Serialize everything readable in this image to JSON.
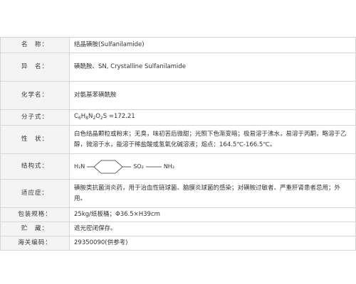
{
  "rows": [
    {
      "label": "名　称：",
      "value": "结晶磺胺(Sulfanilamide)"
    },
    {
      "label": "异　名：",
      "value": "磺酰胺、SN, Crystalline Sulfanilamide"
    },
    {
      "label": "化学名：",
      "value": "对氨基苯磺酰胺"
    },
    {
      "label": "分子式：",
      "value_parts": [
        "C",
        "6",
        "H",
        "8",
        "N",
        "2",
        "O",
        "2",
        "S =172.21"
      ]
    },
    {
      "label": "性　状：",
      "value": "白色结晶颗粒或粉末；无臭，味初苦后微甜；光照下色渐变暗；极易溶于沸水，易溶于丙酮，略溶于乙醇，微溶于水，能溶于稀盐酸或氢氧化碱溶液；熔点：164.5℃-166.5℃。"
    },
    {
      "label": "结构式：",
      "structure": {
        "left": "H₂N",
        "middle": "SO₂",
        "right": "NH₂"
      }
    },
    {
      "label": "适应症：",
      "value": "磺胺类抗菌消炎药，用于治血性链球菌、脑膜炎球菌的感染；对磺胺过敏者、严重肝肾患者忌用；外用。"
    },
    {
      "label": "包装规格：",
      "value": "25kg/纸板桶；Φ36.5×H39cm"
    },
    {
      "label": "贮　藏：",
      "value": "遮光密闭保存。"
    },
    {
      "label": "海关编码：",
      "value": "29350090(供参考)"
    }
  ]
}
